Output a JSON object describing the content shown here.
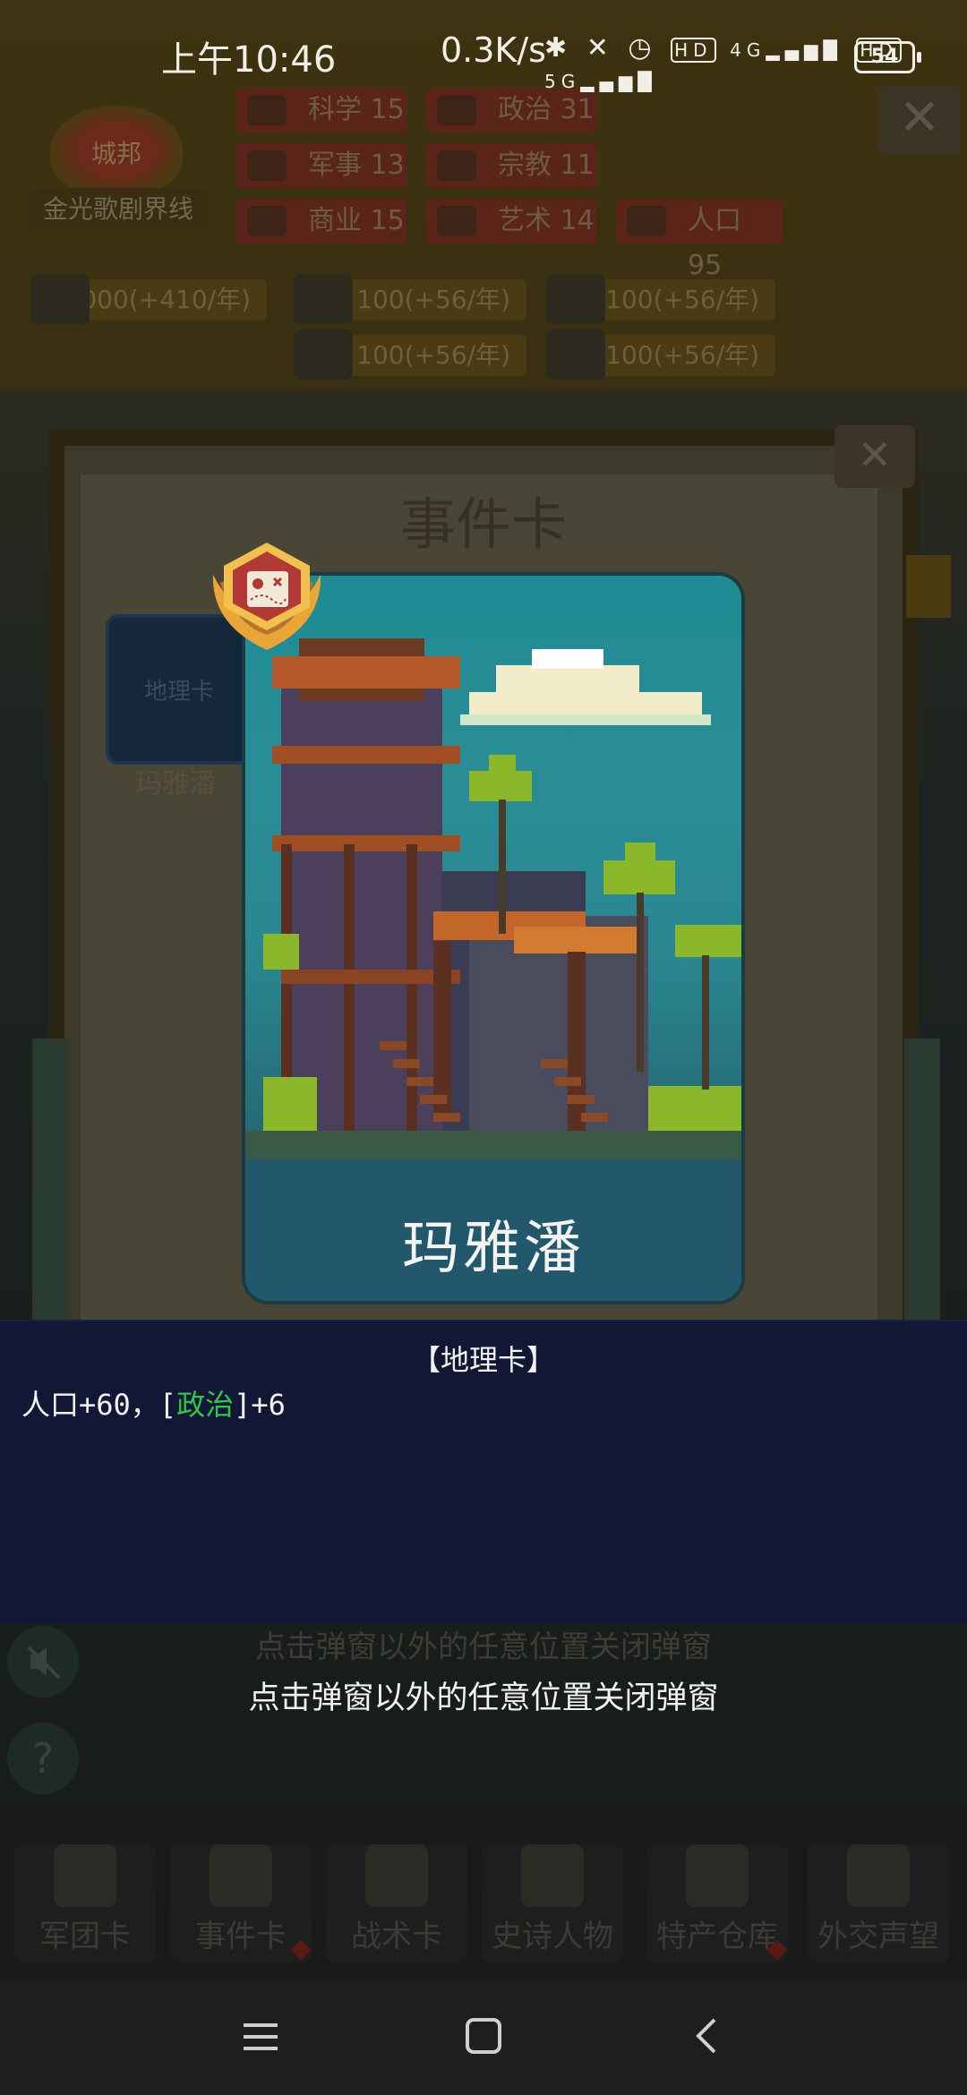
{
  "status_bar": {
    "time": "上午10:46",
    "net_speed": "0.3K/s",
    "icons": [
      "bluetooth-icon",
      "mute-icon",
      "alarm-icon",
      "hd-icon",
      "4g-signal-icon",
      "hd-icon",
      "5g-signal-icon"
    ],
    "sim1_label": "4G",
    "sim2_label": "5G",
    "hd_label": "HD",
    "battery": "54"
  },
  "background": {
    "city_badge": "城邦",
    "city_name": "金光歌剧界线",
    "stats": [
      {
        "label": "科学",
        "value": "15"
      },
      {
        "label": "政治",
        "value": "31"
      },
      {
        "label": "军事",
        "value": "13"
      },
      {
        "label": "宗教",
        "value": "11"
      },
      {
        "label": "商业",
        "value": "15"
      },
      {
        "label": "艺术",
        "value": "14"
      },
      {
        "label": "人口",
        "value": "95"
      }
    ],
    "resources": [
      "1000(+410/年)",
      "100(+56/年)",
      "100(+56/年)",
      "100(+56/年)",
      "100(+56/年)"
    ],
    "panel_title": "事件卡",
    "thumb_label": "地理卡",
    "thumb_name": "玛雅潘",
    "hint_dim": "点击弹窗以外的任意位置关闭弹窗",
    "tabs": [
      "军团卡",
      "事件卡",
      "战术卡",
      "史诗人物",
      "特产仓库",
      "外交声望"
    ]
  },
  "card": {
    "name": "玛雅潘",
    "badge_icon": "map-badge-icon"
  },
  "description": {
    "type_label": "【地理卡】",
    "effect_prefix": "人口+60，[",
    "effect_highlight": "政治",
    "effect_suffix": "]+6",
    "highlight_color": "#2fc74a"
  },
  "close_hint": "点击弹窗以外的任意位置关闭弹窗"
}
